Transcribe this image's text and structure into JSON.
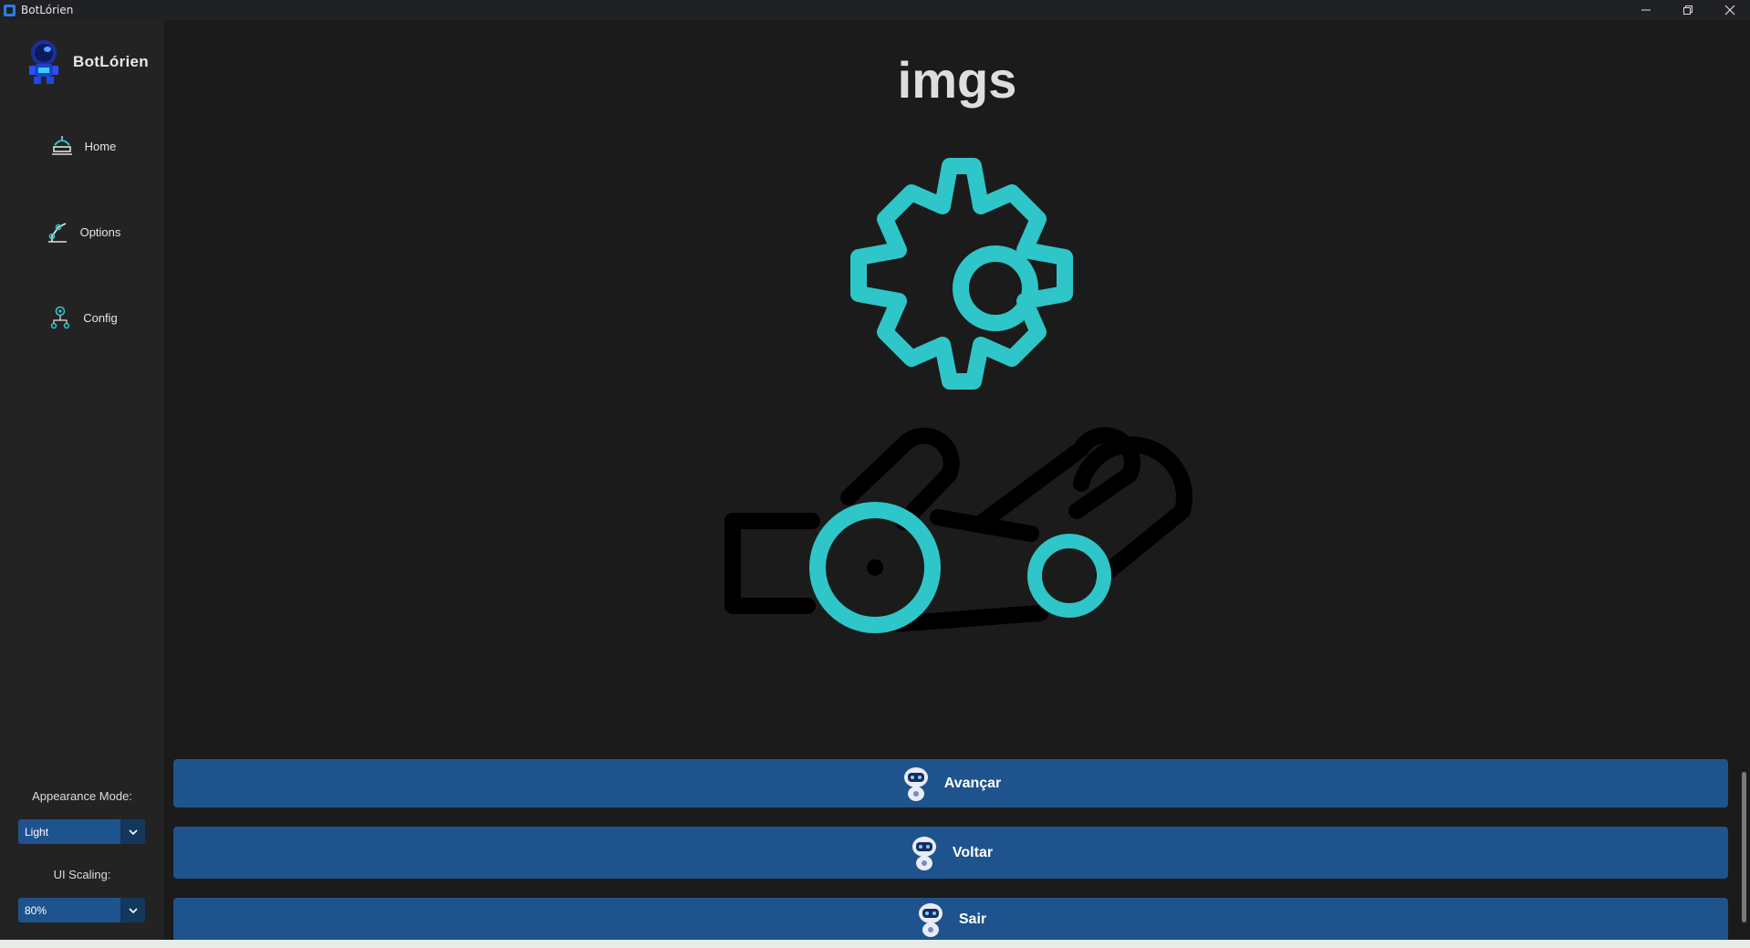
{
  "window": {
    "title": "BotLórien"
  },
  "sidebar": {
    "brand": "BotLórien",
    "nav": [
      {
        "label": "Home",
        "icon": "home-robot-icon"
      },
      {
        "label": "Options",
        "icon": "robot-arm-icon"
      },
      {
        "label": "Config",
        "icon": "config-nodes-icon"
      }
    ],
    "appearance": {
      "label": "Appearance Mode:",
      "value": "Light"
    },
    "scaling": {
      "label": "UI Scaling:",
      "value": "80%"
    }
  },
  "main": {
    "title": "imgs",
    "illustration_icon": "gear-hand-icon",
    "accent_color": "#2ec6c8",
    "buttons": [
      {
        "label": "Avançar",
        "icon": "robot-mascot-icon"
      },
      {
        "label": "Voltar",
        "icon": "robot-mascot-icon"
      },
      {
        "label": "Sair",
        "icon": "robot-mascot-icon"
      }
    ],
    "button_color": "#1f538d"
  }
}
